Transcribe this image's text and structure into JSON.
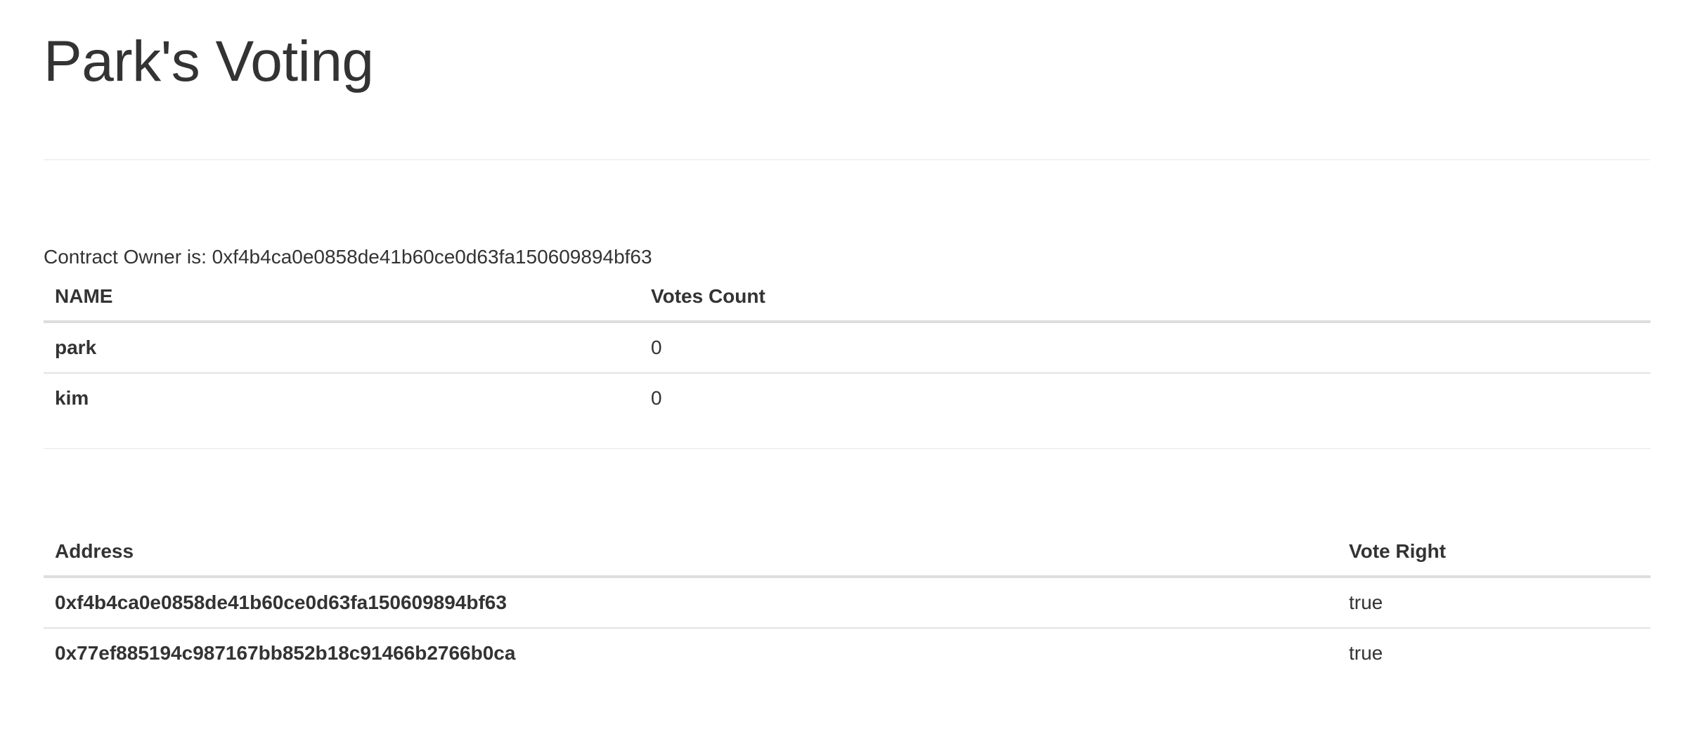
{
  "page": {
    "title": "Park's Voting"
  },
  "owner": {
    "text": "Contract Owner is: 0xf4b4ca0e0858de41b60ce0d63fa150609894bf63"
  },
  "candidates": {
    "headers": [
      "NAME",
      "Votes Count"
    ],
    "rows": [
      {
        "name": "park",
        "votes": "0"
      },
      {
        "name": "kim",
        "votes": "0"
      }
    ]
  },
  "voters": {
    "headers": [
      "Address",
      "Vote Right"
    ],
    "rows": [
      {
        "address": "0xf4b4ca0e0858de41b60ce0d63fa150609894bf63",
        "right": "true"
      },
      {
        "address": "0x77ef885194c987167bb852b18c91466b2766b0ca",
        "right": "true"
      }
    ]
  }
}
